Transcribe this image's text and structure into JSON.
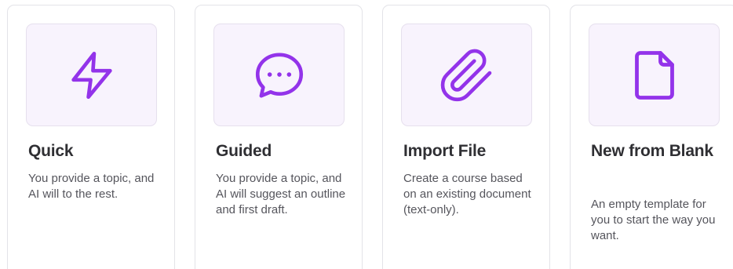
{
  "accent_color": "#9333ea",
  "cards": [
    {
      "title": "Quick",
      "description": "You provide a topic, and AI will to the rest.",
      "icon": "lightning-icon"
    },
    {
      "title": "Guided",
      "description": "You provide a topic, and AI will suggest an outline and first draft.",
      "icon": "chat-bubble-icon"
    },
    {
      "title": "Import File",
      "description": "Create a course based on an existing document (text-only).",
      "icon": "paperclip-icon"
    },
    {
      "title": "New from Blank",
      "description": "An empty template for you to start the way you want.",
      "icon": "blank-file-icon"
    }
  ]
}
